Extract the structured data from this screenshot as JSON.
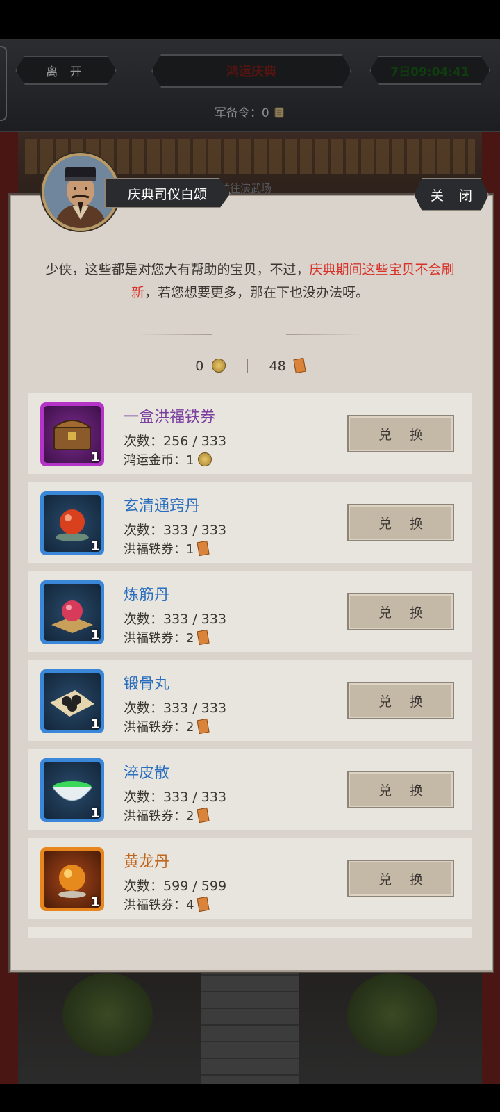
{
  "topbar": {
    "leave_label": "离 开",
    "title": "鸿运庆典",
    "timer": "7日09:04:41",
    "token_label": "军备令：",
    "token_value": "0",
    "token_icon": "scroll-token-icon"
  },
  "npc": {
    "name": "庆典司仪白颂",
    "obscured_tab": "前往演武场"
  },
  "close_label": "关 闭",
  "dialog": {
    "part1": "少侠，这些都是对您大有帮助的宝贝，不过，",
    "highlight": "庆典期间这些宝贝不会刷新",
    "part2": "，若您想要更多，那在下也没办法呀。"
  },
  "currency": {
    "coin_value": "0",
    "coin_icon": "gold-coin-icon",
    "ticket_value": "48",
    "ticket_icon": "iron-ticket-icon"
  },
  "colors": {
    "purple": "#7b3fa0",
    "blue": "#2a6fbe",
    "orange": "#c0661f",
    "highlight_red": "#d8322a"
  },
  "items": [
    {
      "name": "一盒洪福铁券",
      "count_label": "次数：",
      "count": "256 / 333",
      "cost_label": "鸿运金币：",
      "cost": "1",
      "cost_icon": "gold-coin-icon",
      "qty": "1",
      "icon": "treasure-chest-icon",
      "rarity": "purple",
      "button": "兑 换"
    },
    {
      "name": "玄清通窍丹",
      "count_label": "次数：",
      "count": "333 / 333",
      "cost_label": "洪福铁券：",
      "cost": "1",
      "cost_icon": "iron-ticket-icon",
      "qty": "1",
      "icon": "red-pill-icon",
      "rarity": "blue",
      "button": "兑 换"
    },
    {
      "name": "炼筋丹",
      "count_label": "次数：",
      "count": "333 / 333",
      "cost_label": "洪福铁券：",
      "cost": "2",
      "cost_icon": "iron-ticket-icon",
      "qty": "1",
      "icon": "pink-pill-icon",
      "rarity": "blue",
      "button": "兑 换"
    },
    {
      "name": "锻骨丸",
      "count_label": "次数：",
      "count": "333 / 333",
      "cost_label": "洪福铁券：",
      "cost": "2",
      "cost_icon": "iron-ticket-icon",
      "qty": "1",
      "icon": "black-pills-icon",
      "rarity": "blue",
      "button": "兑 换"
    },
    {
      "name": "淬皮散",
      "count_label": "次数：",
      "count": "333 / 333",
      "cost_label": "洪福铁券：",
      "cost": "2",
      "cost_icon": "iron-ticket-icon",
      "qty": "1",
      "icon": "green-bowl-icon",
      "rarity": "blue",
      "button": "兑 换"
    },
    {
      "name": "黄龙丹",
      "count_label": "次数：",
      "count": "599 / 599",
      "cost_label": "洪福铁券：",
      "cost": "4",
      "cost_icon": "iron-ticket-icon",
      "qty": "1",
      "icon": "golden-orb-icon",
      "rarity": "orange",
      "button": "兑 换"
    }
  ]
}
